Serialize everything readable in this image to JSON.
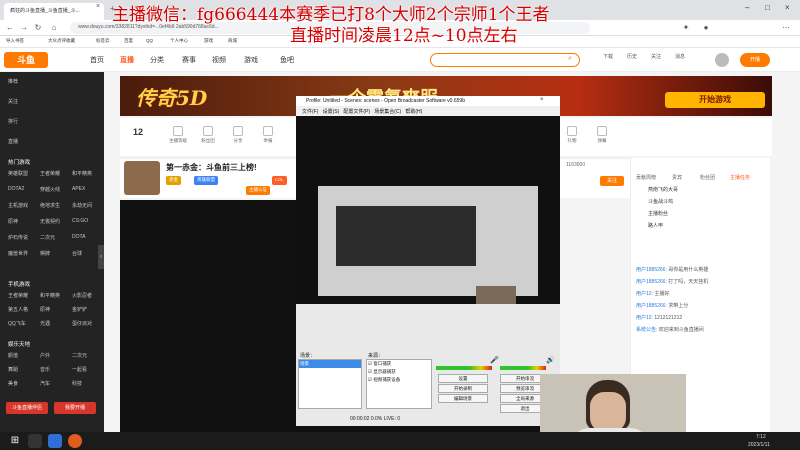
{
  "browser": {
    "tab_title": "疯狂的斗鱼直播_斗鱼直播_斗...",
    "url": "www.douyu.com/3382811?dyshid=...0ef4b9 2ab590d768ac6d...",
    "bookmarks": [
      "导入书签",
      "大众点评收藏",
      "标签云",
      "百度",
      "QQ",
      "个人中心",
      "游戏",
      "商城"
    ]
  },
  "overlay": {
    "line1": "主播微信：fg666444本赛季已打8个大师2个宗师1个王者",
    "line2": "直播时间凌晨12点~10点左右"
  },
  "site": {
    "logo": "斗鱼",
    "nav": [
      "首页",
      "直播",
      "分类",
      "赛事",
      "视频",
      "游戏",
      "鱼吧"
    ],
    "active_nav": "直播",
    "header_icons": [
      "下载",
      "历史",
      "关注",
      "消息"
    ],
    "open_button": "开播",
    "colors": {
      "accent": "#ff7a00",
      "brand": "#ff5d23"
    }
  },
  "sidebar": {
    "top_items": [
      "推荐",
      "关注",
      "排行",
      "直播"
    ],
    "section1_title": "热门游戏",
    "section1_items": [
      [
        "英雄联盟",
        "王者荣耀",
        "和平精英"
      ],
      [
        "DOTA2",
        "穿越火线",
        "APEX"
      ],
      [
        "主机游戏",
        "绝地求生",
        "永劫无间"
      ],
      [
        "原神",
        "无畏契约",
        "CS:GO"
      ],
      [
        "炉石传说",
        "二次元",
        "DOTA"
      ],
      [
        "魔兽世界",
        "棋牌",
        "台球"
      ]
    ],
    "section2_title": "手机游戏",
    "section2_items": [
      [
        "王者荣耀",
        "和平精英",
        "火影忍者"
      ],
      [
        "第五人格",
        "原神",
        "金铲铲"
      ],
      [
        "QQ飞车",
        "光遇",
        "蛋仔派对"
      ]
    ],
    "section3_title": "娱乐天地",
    "section3_items": [
      [
        "颜值",
        "户外",
        "二次元"
      ],
      [
        "舞蹈",
        "音乐",
        "一起看"
      ],
      [
        "美食",
        "汽车",
        "科技"
      ]
    ],
    "btn_download": "斗鱼直播伴侣",
    "btn_start": "我要开播"
  },
  "banner": {
    "text": "传奇5D",
    "button": "开始游戏",
    "subtitle": "一个零氪爽服"
  },
  "categories": {
    "level": "12",
    "items": [
      "主播等级",
      "粉丝团",
      "分享",
      "举报",
      "礼物",
      "弹幕"
    ]
  },
  "room": {
    "title": "第一赤金：斗鱼前三上榜!",
    "tags": [
      "赤金",
      "英雄联盟",
      "主播认证",
      "LOL"
    ],
    "hot": "1163000",
    "follow": "关注"
  },
  "chat": {
    "tabs": [
      "贡献周榜",
      "贵宾",
      "粉丝团",
      "主播任务"
    ],
    "rank": [
      "燕南飞的大哥",
      "斗鱼战斗鸡",
      "主播粉丝",
      "路人甲"
    ],
    "messages": [
      {
        "user": "用户1885266:",
        "text": "哥你是用什么英雄"
      },
      {
        "user": "用户1885266:",
        "text": "打了吗，天天挂机"
      },
      {
        "user": "用户12:",
        "text": "主播好"
      },
      {
        "user": "用户1885266:",
        "text": "求带上分"
      },
      {
        "user": "用户12:",
        "text": "1212121212"
      },
      {
        "user": "系统公告:",
        "text": "欢迎来到斗鱼直播间"
      }
    ]
  },
  "obs": {
    "title": "Profile: Untitled - Scenes: scenes - Open Broadcaster Software v0.659b",
    "menu": [
      "文件(F)",
      "设置(S)",
      "配置文件(P)",
      "场景集合(C)",
      "帮助(H)"
    ],
    "scenes_label": "场景：",
    "scenes": [
      "场景"
    ],
    "sources_label": "来源：",
    "sources": [
      "窗口捕获",
      "显示器捕获",
      "视频捕获设备"
    ],
    "buttons": [
      "设置",
      "开始串流",
      "开始录制",
      "预览串流",
      "编辑场景",
      "全局来源",
      "退出"
    ],
    "status": "00:00:02   0.0%   LIVE: 0"
  },
  "taskbar": {
    "time": "7:12",
    "date": "2023/1/11"
  }
}
